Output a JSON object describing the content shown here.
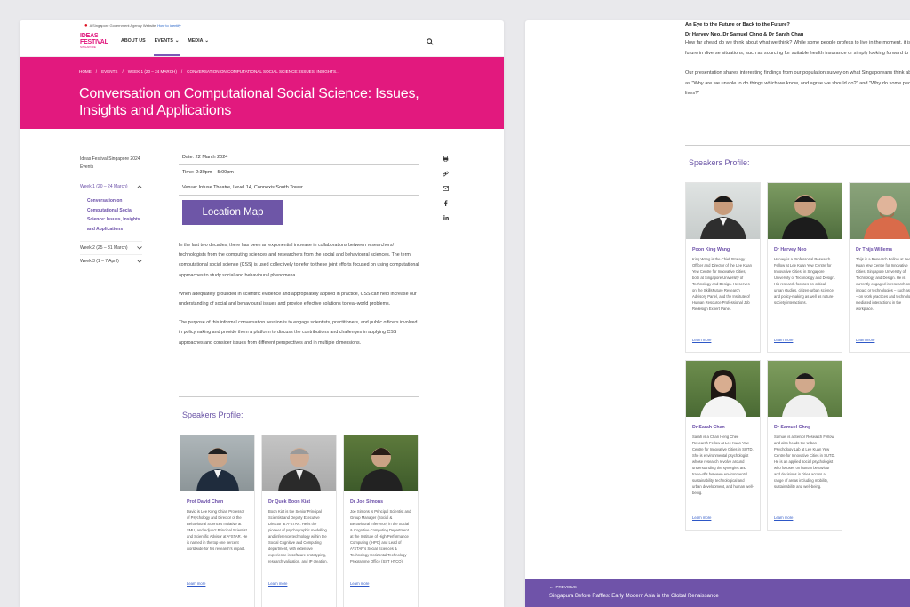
{
  "gov_bar": {
    "text": "A Singapore Government Agency Website",
    "link": "How to identify"
  },
  "logo": {
    "line1": "IDEAS",
    "line2": "FESTIVAL",
    "tagline": "SINGAPORE"
  },
  "nav": {
    "items": [
      {
        "label": "ABOUT US"
      },
      {
        "label": "EVENTS"
      },
      {
        "label": "MEDIA"
      }
    ]
  },
  "breadcrumb": [
    "HOME",
    "EVENTS",
    "WEEK 1 (20 – 24 MARCH)",
    "CONVERSATION ON COMPUTATIONAL SOCIAL SCIENCE: ISSUES, INSIGHTS..."
  ],
  "page_title": "Conversation on Computational Social Science: Issues, Insights and Applications",
  "sidenav": {
    "title": "Ideas Festival Singapore 2024 Events",
    "weeks": [
      {
        "label": "Week 1 (20 – 24 March)"
      },
      {
        "label": "Week 2 (25 – 31 March)"
      },
      {
        "label": "Week 3 (1 – 7 April)"
      }
    ],
    "sub_item": "Conversation on Computational Social Science: Issues, Insights and Applications"
  },
  "event": {
    "date": "Date: 22 March 2024",
    "time": "Time: 2:30pm – 5:00pm",
    "venue": "Venue: Infuse Theatre, Level 14, Connexis South Tower",
    "location_button": "Location Map"
  },
  "body": [
    "In the last two decades, there has been an exponential increase in collaborations between researchers/ technologists from the computing sciences and researchers from the social and behavioural sciences. The term computational social science (CSS) is used collectively to refer to these joint efforts focused on using computational approaches to study social and behavioural phenomena.",
    "When adequately grounded in scientific evidence and appropriately applied in practice, CSS can help increase our understanding of social and behavioural issues and provide effective solutions to real-world problems.",
    "The purpose of this informal conversation session is to engage scientists, practitioners, and public officers involved in policymaking and provide them a platform to discuss the contributions and challenges in applying CSS approaches and consider issues from different perspectives and in multiple dimensions."
  ],
  "speakers_title": "Speakers Profile:",
  "left_speakers": [
    {
      "name": "Prof David Chan",
      "bio": "David is Lee Kong Chian Professor of Psychology and Director of the Behavioural Sciences Initiative at SMU, and Adjunct Principal Scientist and Scientific Advisor at A*STAR. He is named in the top one percent worldwide for his research's impact.",
      "more": "Learn more"
    },
    {
      "name": "Dr Quek Boon Kiat",
      "bio": "Boon Kiat is the Senior Principal Scientist and Deputy Executive Director at A*STAR. He is the pioneer of psychographic modelling and inference technology within the Social Cognitive and Computing department, with extensive experience in software prototyping, research validation, and IP creation.",
      "more": "Learn more"
    },
    {
      "name": "Dr Joe Simons",
      "bio": "Joe Simons is Principal Scientist and Group Manager (Social & Behavioural Inference) in the Social & Cognitive Computing Department at the Institute of High Performance Computing (IHPC) and Lead of A*STAR's Social Sciences & Technology Horizontal Technology Programme Office (SST HTCO).",
      "more": "Learn more"
    }
  ],
  "right_head": {
    "title": "An Eye to the Future or Back to the Future?",
    "authors": "Dr Harvey Neo, Dr Samuel Chng & Dr Sarah Chan"
  },
  "right_text": [
    "How far ahead do we think about what we think? While some people profess to live in the moment, it is not practical nor possible to ignore the future (or past). We think about the future in diverse situations, such as sourcing for suitable health insurance or simply looking forward to celebrating one's favourite holiday.",
    "Our presentation shares interesting findings from our population survey on what Singaporeans think about the future, and offers behavioural insights to perennial questions such as \"Why are we unable to do things which we know, and agree we should do?\" and \"Why do some people appear nonplussed about existential issues which will affect their lives?\""
  ],
  "right_speakers": [
    {
      "name": "Poon King Wang",
      "bio": "King Wang is the Chief Strategy Officer and Director of the Lee Kuan Yew Centre for Innovative Cities, both at Singapore University of Technology and Design. He serves on the SkillsFuture Research Advisory Panel, and the Institute of Human Resource Professional Job Redesign Expert Panel.",
      "more": "Learn more"
    },
    {
      "name": "Dr Harvey Neo",
      "bio": "Harvey is a Professorial Research Fellow at Lee Kuan Yew Centre for Innovative Cities, in Singapore University of Technology and Design. His research focuses on critical urban studies, citizen-urban science and policy-making as well as nature-society interactions.",
      "more": "Learn more"
    },
    {
      "name": "Dr Thijs Willems",
      "bio": "Thijs is a Research Fellow at Lee Kuan Yew Centre for Innovative Cities, Singapore University of Technology and Design. He is currently engaged in research on the impact or technologies – such as AI – on work practices and technology-mediated interactions in the workplace.",
      "more": "Learn more"
    },
    {
      "name": "Dr Sarah Chan",
      "bio": "Sarah is a Chan Heng Chee Research Fellow at Lee Kuan Yew Centre for Innovative Cities in SUTD. She is environmental psychologist whose research revolve around understanding the synergies and trade-offs between environmental sustainability, technological and urban development, and human well-being.",
      "more": "Learn more"
    },
    {
      "name": "Dr Samuel Chng",
      "bio": "Samuel is a Senior Research Fellow and also heads the Urban Psychology Lab at Lee Kuan Yew Centre for Innovative Cities in SUTD. He is an applied social psychologist who focuses on human behaviour and decisions in cities across a range of areas including mobility, sustainability and well-being.",
      "more": "Learn more"
    }
  ],
  "prev": {
    "label": "PREVIOUS",
    "title": "Singapura Before Raffles: Early Modern Asia in the Global Renaissance"
  },
  "colors": {
    "brand_pink": "#e2197e",
    "accent_purple": "#6e56a7"
  }
}
